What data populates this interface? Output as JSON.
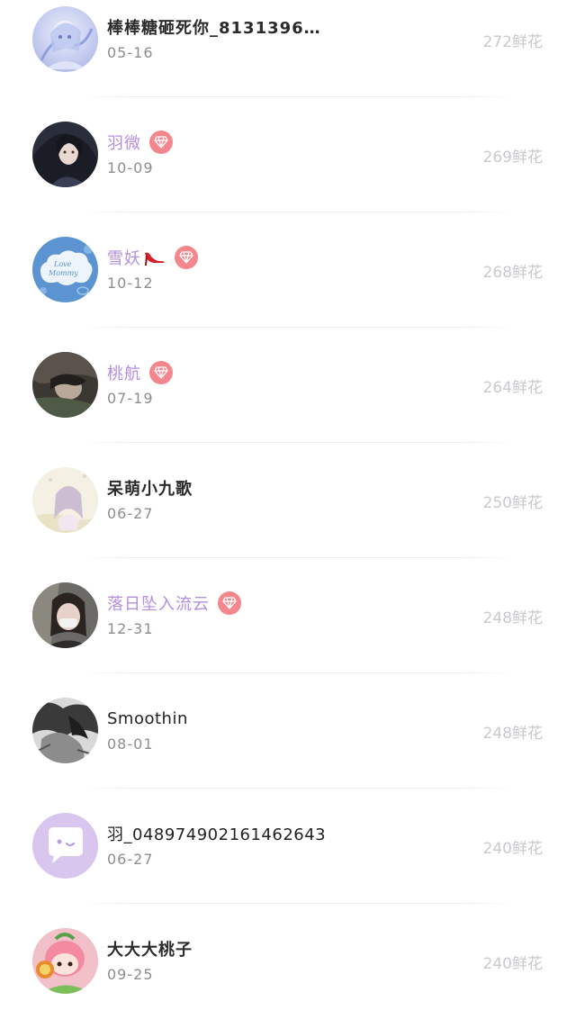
{
  "flower_unit": "鲜花",
  "colors": {
    "vip_name": "#b58ee0",
    "vip_badge": "#f4868e",
    "date_text": "#8d8d93",
    "flowers_text": "#c9c9ce"
  },
  "rows": [
    {
      "name": "棒棒糖砸死你_8131396…",
      "date": "05-16",
      "flowers": "272",
      "vip": false,
      "heel": false,
      "avatar": "anime-girl-lightblue-avatar"
    },
    {
      "name": "羽微",
      "date": "10-09",
      "flowers": "269",
      "vip": true,
      "heel": false,
      "avatar": "anime-warrior-dark-avatar"
    },
    {
      "name": "雪妖",
      "date": "10-12",
      "flowers": "268",
      "vip": true,
      "heel": true,
      "avatar": "love-mommy-cloud-avatar"
    },
    {
      "name": "桃航",
      "date": "07-19",
      "flowers": "264",
      "vip": true,
      "heel": false,
      "avatar": "dark-portrait-avatar"
    },
    {
      "name": "呆萌小九歌",
      "date": "06-27",
      "flowers": "250",
      "vip": false,
      "heel": false,
      "avatar": "pastel-girl-avatar"
    },
    {
      "name": "落日坠入流云",
      "date": "12-31",
      "flowers": "248",
      "vip": true,
      "heel": false,
      "avatar": "masked-girl-avatar"
    },
    {
      "name": "Smoothin",
      "date": "08-01",
      "flowers": "248",
      "vip": false,
      "heel": false,
      "avatar": "grayscale-sketch-avatar"
    },
    {
      "name": "羽_048974902161462643",
      "date": "06-27",
      "flowers": "240",
      "vip": false,
      "heel": false,
      "avatar": "default-chat-bubble-avatar"
    },
    {
      "name": "大大大桃子",
      "date": "09-25",
      "flowers": "240",
      "vip": false,
      "heel": false,
      "avatar": "cartoon-pink-character-avatar"
    }
  ]
}
